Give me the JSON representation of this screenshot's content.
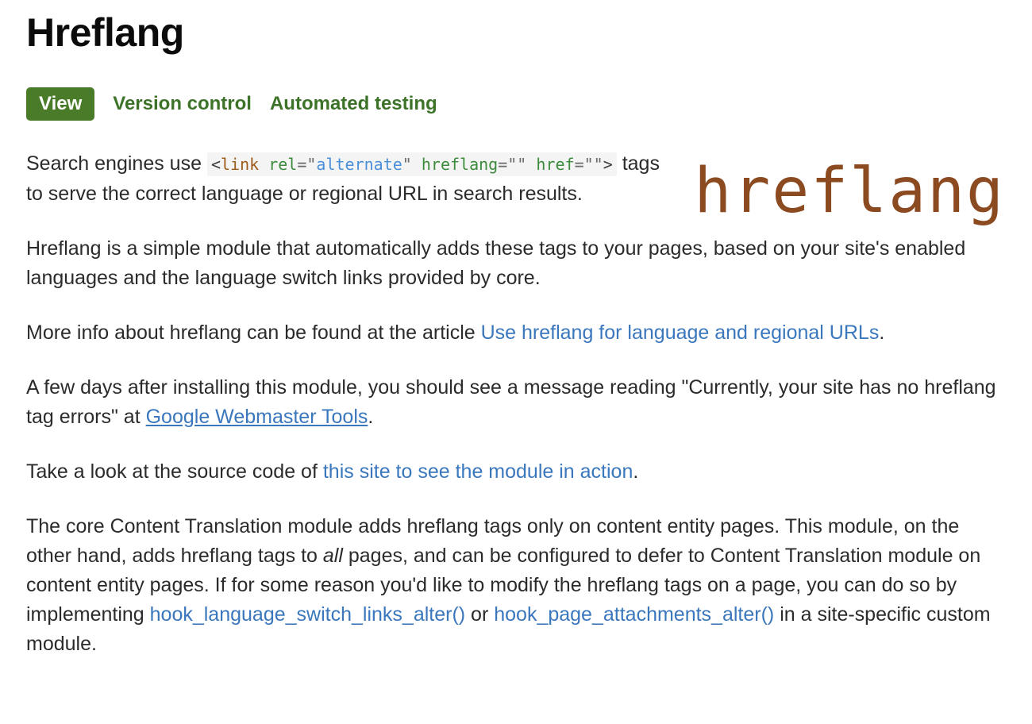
{
  "header": {
    "title": "Hreflang"
  },
  "tabs": [
    {
      "label": "View",
      "active": true
    },
    {
      "label": "Version control",
      "active": false
    },
    {
      "label": "Automated testing",
      "active": false
    }
  ],
  "logo": {
    "text": "hreflang",
    "color": "#8c4a21"
  },
  "colors": {
    "tab_active_bg": "#4a7b28",
    "tab_text": "#3d7328",
    "link": "#3a77bd",
    "body_text": "#2b2b2b",
    "code_bg": "#f4f4f4",
    "code_tag": "#9c5b18",
    "code_attr": "#3c8c3c",
    "code_value": "#4a90d9",
    "code_punct": "#3c3c3c"
  },
  "intro": {
    "before_code": "Search engines use ",
    "code": {
      "open_bracket": "<",
      "tag_name": "link",
      "attr_rel": "rel",
      "eq1": "=",
      "quote_open1": "\"",
      "value_alternate": "alternate",
      "quote_close1": "\"",
      "attr_hreflang": "hreflang",
      "eq2": "=",
      "empty_quotes1": "\"\"",
      "attr_href": "href",
      "eq3": "=",
      "empty_quotes2": "\"\"",
      "close_bracket": ">"
    },
    "after_code": " tags to serve the correct language or regional URL in search results."
  },
  "paragraphs": {
    "p1": "Hreflang is a simple module that automatically adds these tags to your pages, based on your site's enabled languages and the language switch links provided by core.",
    "p2_before": "More info about hreflang can be found at the article ",
    "p2_link": "Use hreflang for language and regional URLs",
    "p2_after": ".",
    "p3_before": "A few days after installing this module, you should see a message reading \"Currently, your site has no hreflang tag errors\" at ",
    "p3_link": "Google Webmaster Tools",
    "p3_after": ".",
    "p4_before": "Take a look at the source code of ",
    "p4_link": "this site to see the module in action",
    "p4_after": ".",
    "p5_part1": "The core Content Translation module adds hreflang tags only on content entity pages. This module, on the other hand, adds hreflang tags to ",
    "p5_italic": "all",
    "p5_part2": " pages, and can be configured to defer to Content Translation module on content entity pages. If for some reason you'd like to modify the hreflang tags on a page, you can do so by implementing ",
    "p5_link1": "hook_language_switch_links_alter()",
    "p5_part3": " or ",
    "p5_link2": "hook_page_attachments_alter()",
    "p5_part4": " in a site-specific custom module."
  }
}
